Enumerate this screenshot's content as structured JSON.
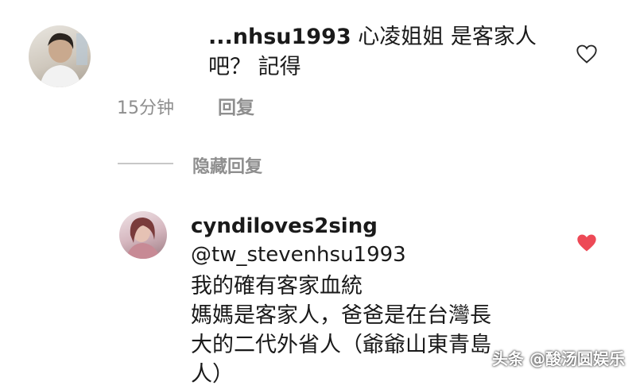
{
  "comment1": {
    "username_partial": "...nhsu1993",
    "text": "心凌姐姐 是客家人\n吧？ 記得",
    "time": "15分钟",
    "reply_label": "回复",
    "liked": false
  },
  "hide_replies_label": "隐藏回复",
  "comment2": {
    "username": "cyndiloves2sing",
    "mention": "@tw_stevenhsu1993",
    "text": "我的確有客家血統\n媽媽是客家人，爸爸是在台灣長\n大的二代外省人（爺爺山東青島\n人）",
    "liked": true
  },
  "watermark": "头条 @酸汤圆娱乐",
  "colors": {
    "heart_liked": "#ed4956",
    "heart_outline": "#262626",
    "meta_gray": "#8e8e8e"
  }
}
